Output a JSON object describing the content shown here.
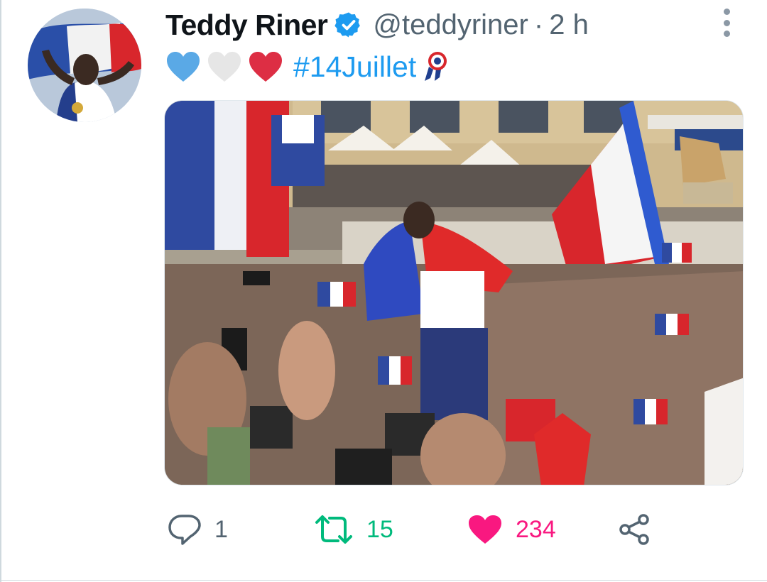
{
  "tweet": {
    "display_name": "Teddy Riner",
    "handle": "@teddyriner",
    "separator": "·",
    "time": "2 h",
    "hashtag": "#14Juillet",
    "emoji": [
      "blue-heart-icon",
      "white-heart-icon",
      "red-heart-icon",
      "rosette-icon"
    ],
    "colors": {
      "blue_heart": "#5aa9e6",
      "white_heart": "#e6e6e6",
      "red_heart": "#dd2e44",
      "link": "#1d9bf0",
      "retweet_active": "#00ba7c",
      "like_active": "#f91880",
      "muted": "#536471"
    }
  },
  "actions": {
    "reply_count": "1",
    "retweet_count": "15",
    "like_count": "234"
  }
}
